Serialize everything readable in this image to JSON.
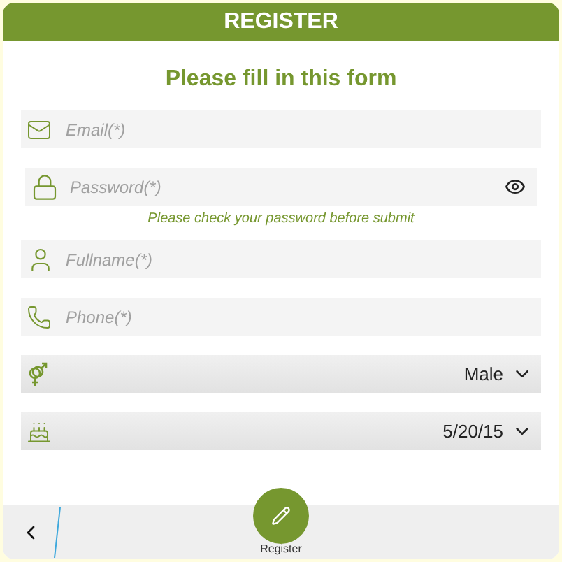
{
  "header": {
    "title": "REGISTER"
  },
  "form": {
    "heading": "Please fill in this form",
    "fields": [
      {
        "kind": "text",
        "placeholder": "Email(*)"
      },
      {
        "kind": "password",
        "placeholder": "Password(*)",
        "hint": "Please check your password before submit"
      },
      {
        "kind": "text",
        "placeholder": "Fullname(*)"
      },
      {
        "kind": "text",
        "placeholder": "Phone(*)"
      },
      {
        "kind": "select",
        "value": "Male"
      },
      {
        "kind": "select",
        "value": "5/20/15"
      }
    ]
  },
  "bottom_bar": {
    "action": {
      "label": "Register"
    }
  }
}
